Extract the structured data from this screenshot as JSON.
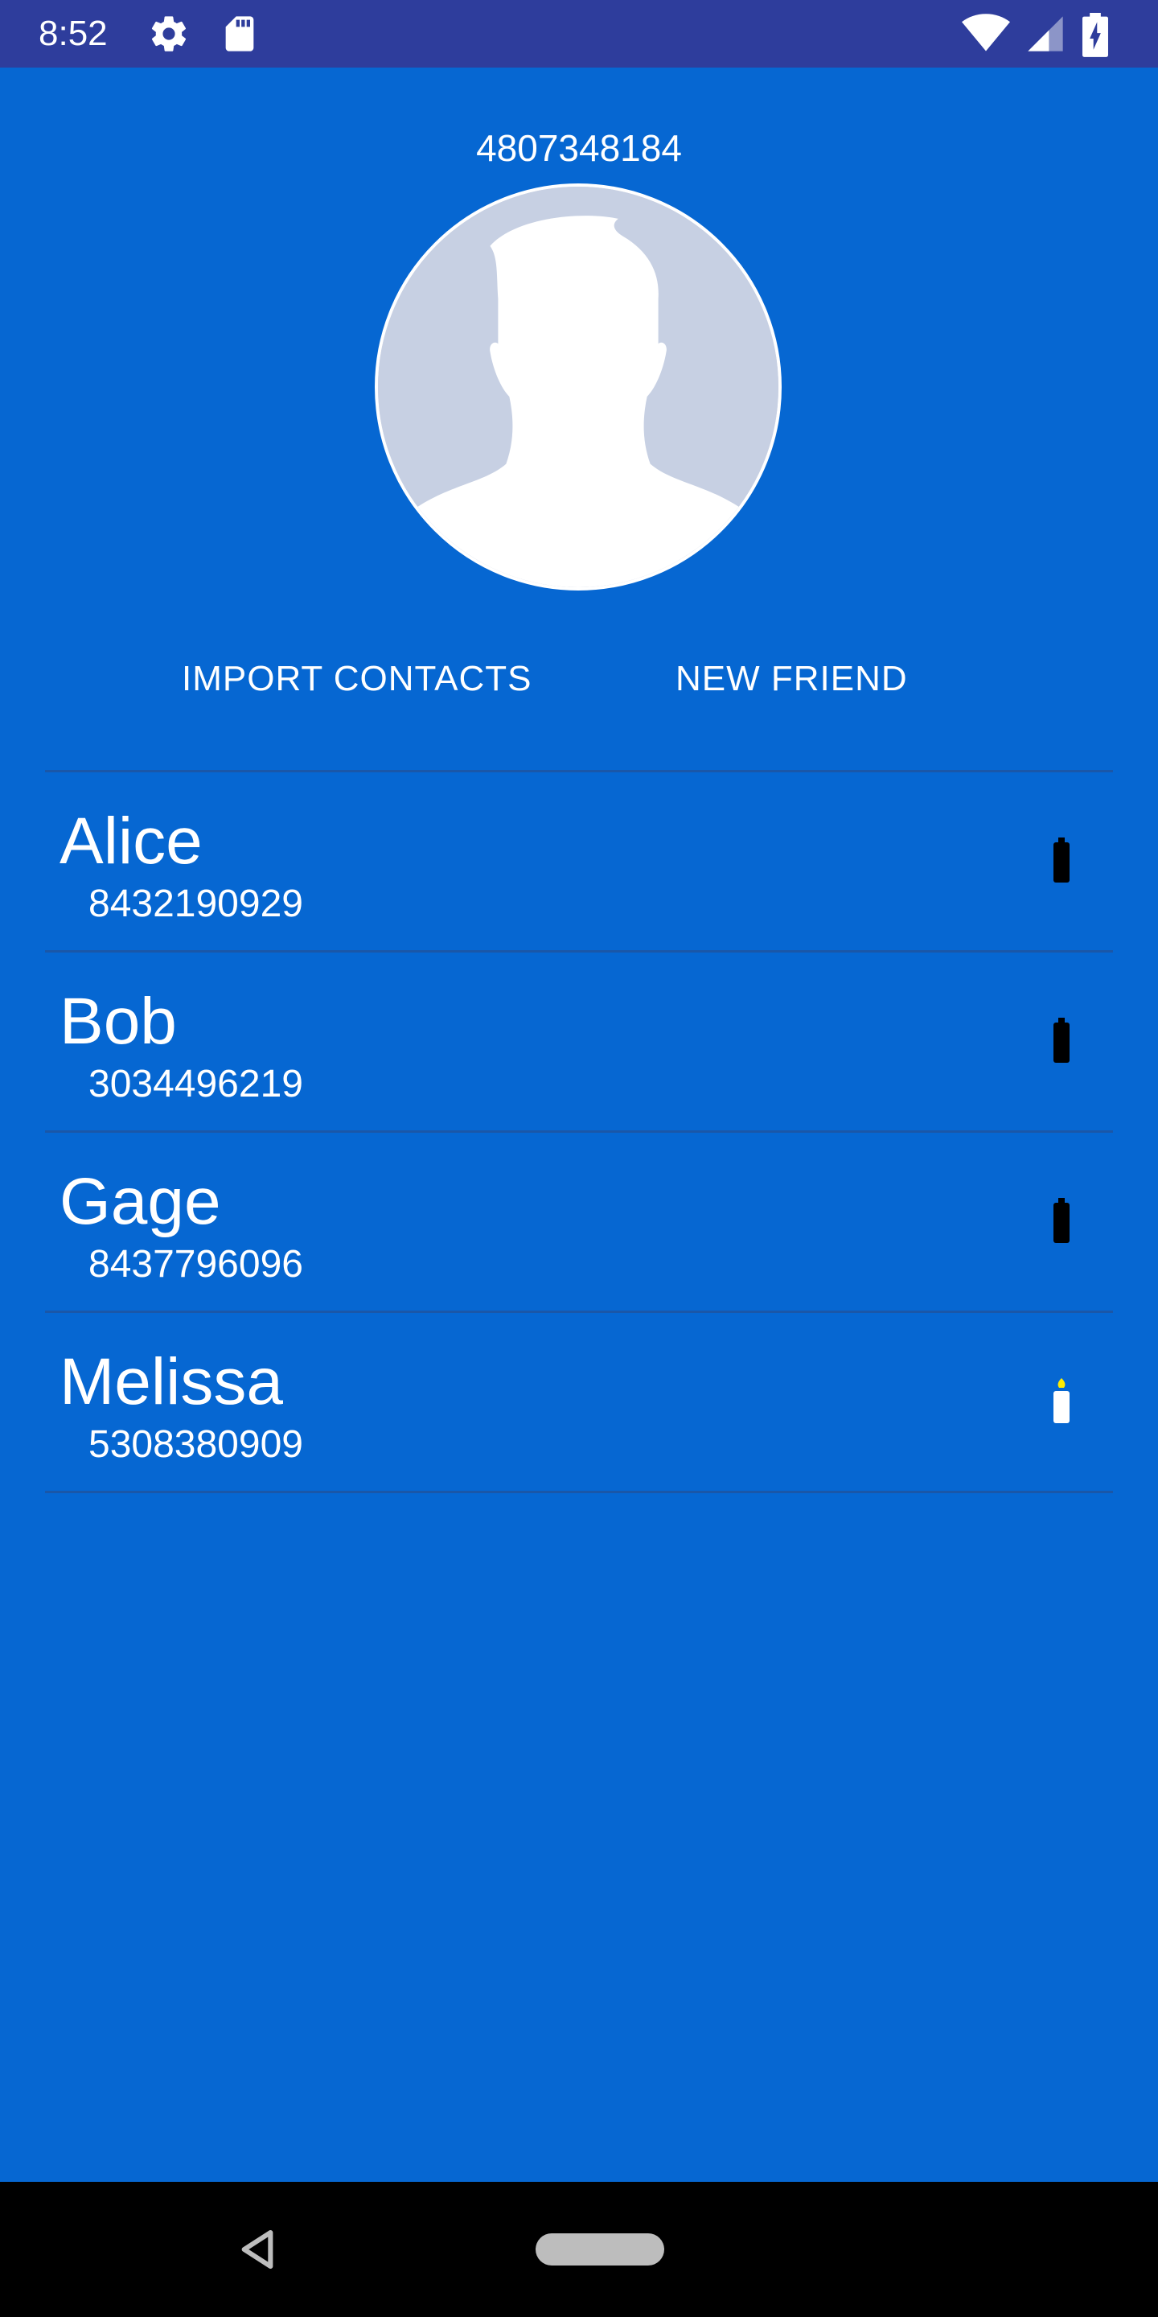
{
  "status_bar": {
    "time": "8:52",
    "icons": [
      "settings-icon",
      "sd-card-icon",
      "wifi-icon",
      "signal-icon",
      "battery-charging-icon"
    ]
  },
  "profile": {
    "own_number": "4807348184",
    "avatar_icon": "person-silhouette-icon"
  },
  "actions": {
    "import_label": "IMPORT CONTACTS",
    "new_friend_label": "NEW FRIEND"
  },
  "contacts": [
    {
      "name": "Alice",
      "number": "8432190929",
      "status_icon": "battery-icon",
      "active": false
    },
    {
      "name": "Bob",
      "number": "3034496219",
      "status_icon": "battery-icon",
      "active": false
    },
    {
      "name": "Gage",
      "number": "8437796096",
      "status_icon": "battery-icon",
      "active": false
    },
    {
      "name": "Melissa",
      "number": "5308380909",
      "status_icon": "candle-icon",
      "active": true
    }
  ],
  "nav_bar": {
    "icons": [
      "back-icon",
      "home-pill-icon"
    ]
  },
  "colors": {
    "background": "#0667D2",
    "status_bar": "#2E3D9C",
    "divider": "#1A57A8",
    "avatar_bg": "#C7D0E3",
    "flame": "#FFEB00"
  }
}
